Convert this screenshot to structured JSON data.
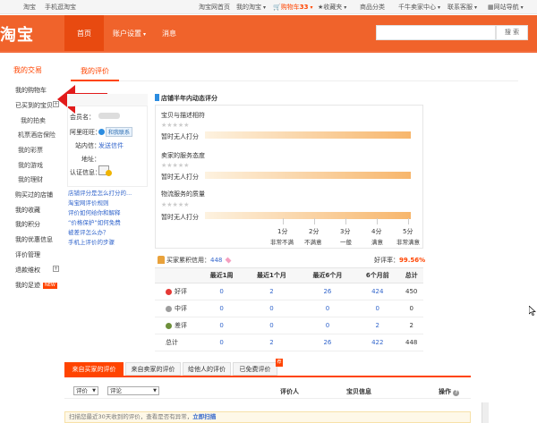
{
  "topbar": {
    "home": "淘宝",
    "mobile": "手机逛淘宝",
    "links": [
      "淘宝网首页",
      "我的淘宝",
      "购物车",
      "收藏夹",
      "商品分类",
      "千牛卖家中心",
      "联系客服",
      "网站导航"
    ],
    "cart_count": "33"
  },
  "header": {
    "logo": "淘宝",
    "nav": [
      "首页",
      "账户设置",
      "消息"
    ],
    "search_button": "搜 索"
  },
  "sidebar": {
    "title": "我的交易",
    "items": [
      {
        "label": "我的购物车"
      },
      {
        "label": "已买到的宝贝",
        "has_toggle": true
      },
      {
        "label": "我的拍卖",
        "sub": true
      },
      {
        "label": "机票酒店保险",
        "sub": true
      },
      {
        "label": "我的彩票",
        "sub": true
      },
      {
        "label": "我的游戏",
        "sub": true
      },
      {
        "label": "我的理财",
        "sub": true
      },
      {
        "label": "购买过的店铺"
      },
      {
        "label": "我的收藏"
      },
      {
        "label": "我的积分"
      },
      {
        "label": "我的优惠信息"
      },
      {
        "label": "评价管理"
      },
      {
        "label": "退款维权",
        "has_toggle": true
      },
      {
        "label": "我的足迹",
        "badge": "NEW"
      }
    ]
  },
  "main": {
    "tab": "我的评价"
  },
  "user": {
    "name_label": "会员名：",
    "ww_label": "阿里旺旺：",
    "ww_badge": "和我联系",
    "site_label": "站内信：",
    "site_link": "发送信件",
    "addr_label": "地址：",
    "cert_label": "认证信息："
  },
  "faq": [
    "店铺评分是怎么打分的...",
    "淘宝网评价规则",
    "评价如何给你和解释",
    "“价格保护”如何免费",
    "被差评怎么办？",
    "手机上评价的步骤"
  ],
  "rating": {
    "title": "店铺半年内动态评分",
    "items": [
      {
        "label": "宝贝与描述相符",
        "stars": "★★★★★",
        "value": "暂时无人打分"
      },
      {
        "label": "卖家的服务态度",
        "stars": "★★★★★",
        "value": "暂时无人打分"
      },
      {
        "label": "物流服务的质量",
        "stars": "★★★★★",
        "value": "暂时无人打分"
      }
    ],
    "scale": [
      {
        "num": "1分",
        "word": "非常不满"
      },
      {
        "num": "2分",
        "word": "不满意"
      },
      {
        "num": "3分",
        "word": "一般"
      },
      {
        "num": "4分",
        "word": "满意"
      },
      {
        "num": "5分",
        "word": "非常满意"
      }
    ]
  },
  "credit": {
    "title": "买家累积信用：",
    "value": "448",
    "good_rate_label": "好评率：",
    "good_rate": "99.56%",
    "headers": [
      "",
      "最近1周",
      "最近1个月",
      "最近6个月",
      "6个月前",
      "总计"
    ],
    "rows": [
      {
        "label": "好评",
        "icon_color": "#e53935",
        "values": [
          "0",
          "2",
          "26",
          "424",
          "450"
        ]
      },
      {
        "label": "中评",
        "icon_color": "#9e9e9e",
        "values": [
          "0",
          "0",
          "0",
          "0",
          "0"
        ]
      },
      {
        "label": "差评",
        "icon_color": "#6d8f3a",
        "values": [
          "0",
          "0",
          "0",
          "2",
          "2"
        ]
      },
      {
        "label": "总计",
        "icon_color": "",
        "values": [
          "0",
          "2",
          "26",
          "422",
          "448"
        ]
      }
    ]
  },
  "bottom": {
    "tabs": [
      "来自买家的评价",
      "来自卖家的评价",
      "给他人的评价",
      "已免费评价"
    ],
    "hot": "荐",
    "filter1": "评价",
    "filter2": "评论",
    "col_rater": "评价人",
    "col_item": "宝贝信息",
    "col_op": "操作",
    "notice_text": "扫描您最近30天收到的评价，查看是否有异常，",
    "notice_link": "立即扫描"
  }
}
